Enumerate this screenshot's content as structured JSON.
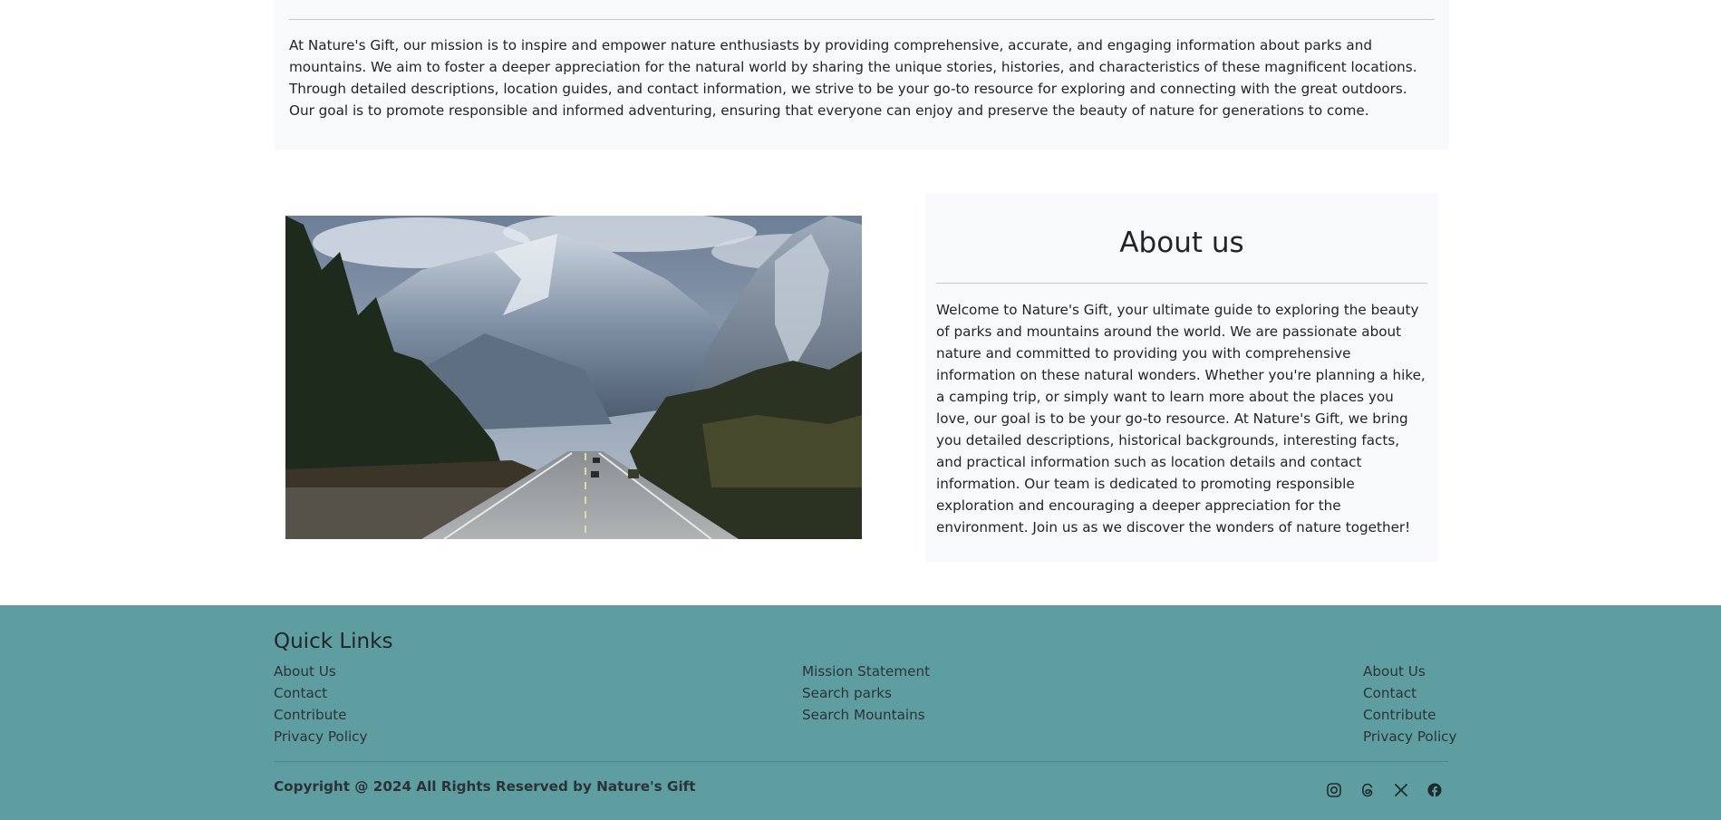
{
  "mission": {
    "text": "At Nature's Gift, our mission is to inspire and empower nature enthusiasts by providing comprehensive, accurate, and engaging information about parks and mountains. We aim to foster a deeper appreciation for the natural world by sharing the unique stories, histories, and characteristics of these magnificent locations. Through detailed descriptions, location guides, and contact information, we strive to be your go-to resource for exploring and connecting with the great outdoors. Our goal is to promote responsible and informed adventuring, ensuring that everyone can enjoy and preserve the beauty of nature for generations to come."
  },
  "about": {
    "title": "About us",
    "text": "Welcome to Nature's Gift, your ultimate guide to exploring the beauty of parks and mountains around the world. We are passionate about nature and committed to providing you with comprehensive information on these natural wonders. Whether you're planning a hike, a camping trip, or simply want to learn more about the places you love, our goal is to be your go-to resource. At Nature's Gift, we bring you detailed descriptions, historical backgrounds, interesting facts, and practical information such as location details and contact information. Our team is dedicated to promoting responsible exploration and encouraging a deeper appreciation for the environment. Join us as we discover the wonders of nature together!"
  },
  "footer": {
    "title": "Quick Links",
    "col1": [
      "About Us",
      "Contact",
      "Contribute",
      "Privacy Policy"
    ],
    "col2": [
      "Mission Statement",
      "Search parks",
      "Search Mountains"
    ],
    "col3": [
      "About Us",
      "Contact",
      "Contribute",
      "Privacy Policy"
    ],
    "copyright": "Copyright @ 2024 All Rights Reserved by Nature's Gift",
    "socials": [
      "instagram-icon",
      "threads-icon",
      "x-icon",
      "facebook-icon"
    ]
  },
  "colors": {
    "footer_bg": "#5f9ea0",
    "panel_bg": "#f8f9fa",
    "text": "#212529"
  }
}
